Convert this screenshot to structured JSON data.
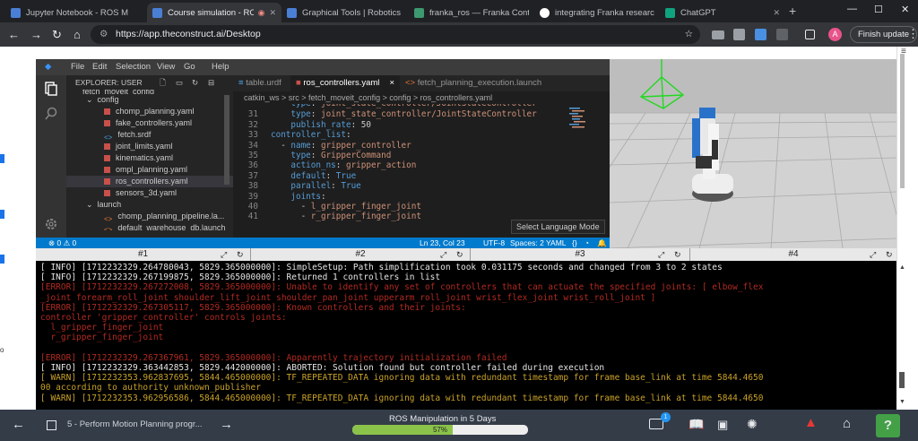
{
  "browser": {
    "tabs": [
      {
        "title": "Jupyter Notebook - ROS M",
        "color": "#4a7fd6"
      },
      {
        "title": "Course simulation - RO",
        "color": "#4a7fd6"
      },
      {
        "title": "Graphical Tools | Robotics",
        "color": "#4a7fd6"
      },
      {
        "title": "franka_ros — Franka Contr",
        "color": "#3d9970"
      },
      {
        "title": "integrating Franka research",
        "color": "#ffffff"
      },
      {
        "title": "ChatGPT",
        "color": "#10a37f"
      }
    ],
    "url": "https://app.theconstruct.ai/Desktop",
    "avatar": "A",
    "finish_update": "Finish update"
  },
  "vscode": {
    "menu": [
      "File",
      "Edit",
      "Selection",
      "View",
      "Go",
      "Help"
    ],
    "explorer_title": "EXPLORER: USER",
    "tree": [
      {
        "label": "fetch_moveit_config",
        "type": "folder-partial"
      },
      {
        "label": "config",
        "type": "folder"
      },
      {
        "label": "chomp_planning.yaml",
        "type": "yaml"
      },
      {
        "label": "fake_controllers.yaml",
        "type": "yaml"
      },
      {
        "label": "fetch.srdf",
        "type": "xml"
      },
      {
        "label": "joint_limits.yaml",
        "type": "yaml"
      },
      {
        "label": "kinematics.yaml",
        "type": "yaml"
      },
      {
        "label": "ompl_planning.yaml",
        "type": "yaml"
      },
      {
        "label": "ros_controllers.yaml",
        "type": "yaml",
        "selected": true
      },
      {
        "label": "sensors_3d.yaml",
        "type": "yaml"
      },
      {
        "label": "launch",
        "type": "folder"
      },
      {
        "label": "chomp_planning_pipeline.la...",
        "type": "xml"
      },
      {
        "label": "default_warehouse_db.launch",
        "type": "xml"
      }
    ],
    "editor_tabs": [
      {
        "label": "table.urdf",
        "active": false
      },
      {
        "label": "ros_controllers.yaml",
        "active": true,
        "close": "×"
      },
      {
        "label": "fetch_planning_execution.launch",
        "active": false
      }
    ],
    "breadcrumbs": "catkin_ws  >  src  >  fetch_moveit_config  >  config  >  ros_controllers.yaml",
    "code": [
      {
        "n": "",
        "parts": [
          {
            "t": "    ",
            "c": "v"
          },
          {
            "t": "type",
            "c": "k"
          },
          {
            "t": ": ",
            "c": "v"
          },
          {
            "t": "joint_state_controller/JointStateController",
            "c": "s"
          }
        ]
      },
      {
        "n": "31",
        "parts": [
          {
            "t": "    ",
            "c": "v"
          },
          {
            "t": "type",
            "c": "k"
          },
          {
            "t": ": ",
            "c": "v"
          },
          {
            "t": "joint_state_controller/JointStateController",
            "c": "s"
          }
        ]
      },
      {
        "n": "32",
        "parts": [
          {
            "t": "    ",
            "c": "v"
          },
          {
            "t": "publish_rate",
            "c": "k"
          },
          {
            "t": ": 50",
            "c": "v"
          }
        ]
      },
      {
        "n": "33",
        "parts": [
          {
            "t": "controller_list",
            "c": "k"
          },
          {
            "t": ":",
            "c": "v"
          }
        ]
      },
      {
        "n": "34",
        "parts": [
          {
            "t": "  - ",
            "c": "v"
          },
          {
            "t": "name",
            "c": "k"
          },
          {
            "t": ": ",
            "c": "v"
          },
          {
            "t": "gripper_controller",
            "c": "s"
          }
        ]
      },
      {
        "n": "35",
        "parts": [
          {
            "t": "    ",
            "c": "v"
          },
          {
            "t": "type",
            "c": "k"
          },
          {
            "t": ": ",
            "c": "v"
          },
          {
            "t": "GripperCommand",
            "c": "s"
          }
        ]
      },
      {
        "n": "36",
        "parts": [
          {
            "t": "    ",
            "c": "v"
          },
          {
            "t": "action_ns",
            "c": "k"
          },
          {
            "t": ": ",
            "c": "v"
          },
          {
            "t": "gripper_action",
            "c": "s"
          }
        ]
      },
      {
        "n": "37",
        "parts": [
          {
            "t": "    ",
            "c": "v"
          },
          {
            "t": "default",
            "c": "k"
          },
          {
            "t": ": ",
            "c": "v"
          },
          {
            "t": "True",
            "c": "k"
          }
        ]
      },
      {
        "n": "38",
        "parts": [
          {
            "t": "    ",
            "c": "v"
          },
          {
            "t": "parallel",
            "c": "k"
          },
          {
            "t": ": ",
            "c": "v"
          },
          {
            "t": "True",
            "c": "k"
          }
        ]
      },
      {
        "n": "39",
        "parts": [
          {
            "t": "    ",
            "c": "v"
          },
          {
            "t": "joints",
            "c": "k"
          },
          {
            "t": ":",
            "c": "v"
          }
        ]
      },
      {
        "n": "40",
        "parts": [
          {
            "t": "      - ",
            "c": "v"
          },
          {
            "t": "l_gripper_finger_joint",
            "c": "s"
          }
        ]
      },
      {
        "n": "41",
        "parts": [
          {
            "t": "      - ",
            "c": "v"
          },
          {
            "t": "r_gripper_finger_joint",
            "c": "s"
          }
        ]
      }
    ],
    "tooltip": "Select Language Mode",
    "status": {
      "problems": "⊗ 0  ⚠ 0",
      "position": "Ln 23, Col 23",
      "encoding": "UTF-8",
      "spaces": "Spaces: 2",
      "language": "YAML"
    }
  },
  "terminal_tabs": [
    "#1",
    "#2",
    "#3",
    "#4"
  ],
  "terminal": [
    {
      "c": "w",
      "t": "[ INFO] [1712232329.264780043, 5829.365000000]: SimpleSetup: Path simplification took 0.031175 seconds and changed from 3 to 2 states"
    },
    {
      "c": "w",
      "t": "[ INFO] [1712232329.267199875, 5829.365000000]: Returned 1 controllers in list"
    },
    {
      "c": "r",
      "t": "[ERROR] [1712232329.267272008, 5829.365000000]: Unable to identify any set of controllers that can actuate the specified joints: [ elbow_flex"
    },
    {
      "c": "r",
      "t": "_joint forearm_roll_joint shoulder_lift_joint shoulder_pan_joint upperarm_roll_joint wrist_flex_joint wrist_roll_joint ]"
    },
    {
      "c": "r",
      "t": "[ERROR] [1712232329.267305117, 5829.365000000]: Known controllers and their joints:"
    },
    {
      "c": "r",
      "t": "controller 'gripper_controller' controls joints:"
    },
    {
      "c": "r",
      "t": "  l_gripper_finger_joint"
    },
    {
      "c": "r",
      "t": "  r_gripper_finger_joint"
    },
    {
      "c": "r",
      "t": ""
    },
    {
      "c": "r",
      "t": "[ERROR] [1712232329.267367961, 5829.365000000]: Apparently trajectory initialization failed"
    },
    {
      "c": "w",
      "t": "[ INFO] [1712232329.363442853, 5829.442000000]: ABORTED: Solution found but controller failed during execution"
    },
    {
      "c": "o",
      "t": "[ WARN] [1712232353.962837695, 5844.465000000]: TF_REPEATED_DATA ignoring data with redundant timestamp for frame base_link at time 5844.4650"
    },
    {
      "c": "o",
      "t": "00 according to authority unknown_publisher"
    },
    {
      "c": "o",
      "t": "[ WARN] [1712232353.962956586, 5844.465000000]: TF_REPEATED_DATA ignoring data with redundant timestamp for frame base_link at time 5844.4650"
    }
  ],
  "bottom": {
    "lesson": "5 - Perform Motion Planning progr...",
    "course_title": "ROS Manipulation in 5 Days",
    "progress_label": "57%",
    "progress": 0.57,
    "badge": "1",
    "help": "?"
  }
}
